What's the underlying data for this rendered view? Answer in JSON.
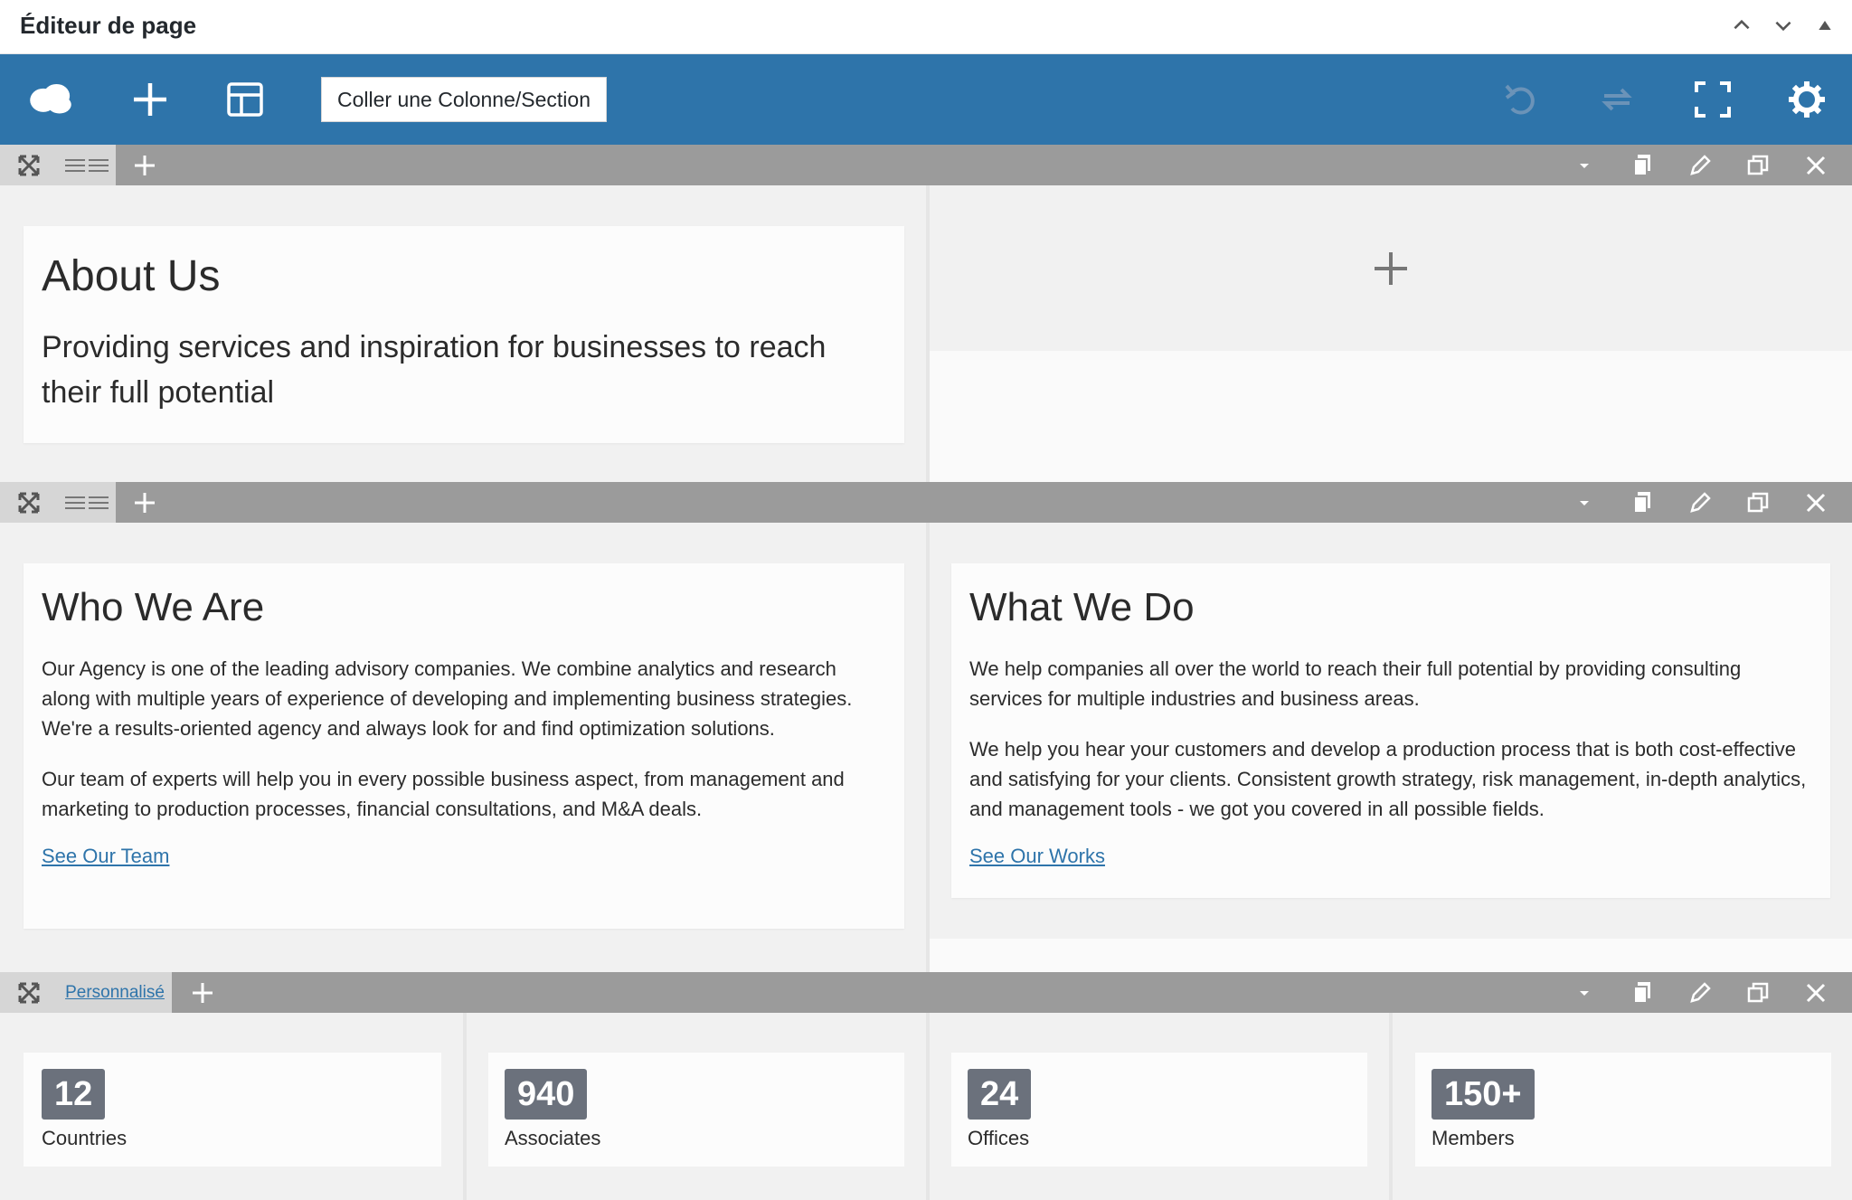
{
  "app": {
    "title": "Éditeur de page",
    "window_controls": [
      "chevron-up-icon",
      "chevron-down-icon",
      "collapse-triangle-icon"
    ]
  },
  "toolbar": {
    "bg_color": "#2e74aa",
    "icons": [
      "cloud-icon",
      "plus-icon",
      "layout-icon"
    ],
    "paste_label": "Coller une Colonne/Section",
    "right_icons": [
      "undo-icon",
      "redo-icon",
      "fullscreen-icon",
      "gear-icon"
    ]
  },
  "rows": [
    {
      "preset": "",
      "columns": [
        {
          "heading": "About Us",
          "lead": "Providing services and inspiration for businesses to reach their full potential"
        },
        {
          "empty": true
        }
      ]
    },
    {
      "preset": "",
      "columns": [
        {
          "heading": "Who We Are",
          "paragraphs": [
            "Our Agency is one of the leading advisory companies. We combine analytics and research along with multiple years of experience of developing and implementing business strategies. We're a results-oriented agency and always look for and find optimization solutions.",
            "Our team of experts will help you in every possible business aspect, from management and marketing to production processes, financial consultations, and M&A deals."
          ],
          "link": "See Our Team"
        },
        {
          "heading": "What We Do",
          "paragraphs": [
            "We help companies all over the world to reach their full potential by providing consulting services for multiple industries and business areas.",
            "We help you hear your customers and develop a production process that is both cost-effective and satisfying for your clients. Consistent growth strategy, risk management, in-depth analytics, and management tools - we got you covered in all possible fields."
          ],
          "link": "See Our Works"
        }
      ]
    },
    {
      "preset": "Personnalisé",
      "stats": [
        {
          "value": "12",
          "label": "Countries"
        },
        {
          "value": "940",
          "label": "Associates"
        },
        {
          "value": "24",
          "label": "Offices"
        },
        {
          "value": "150+",
          "label": "Members"
        }
      ]
    }
  ]
}
